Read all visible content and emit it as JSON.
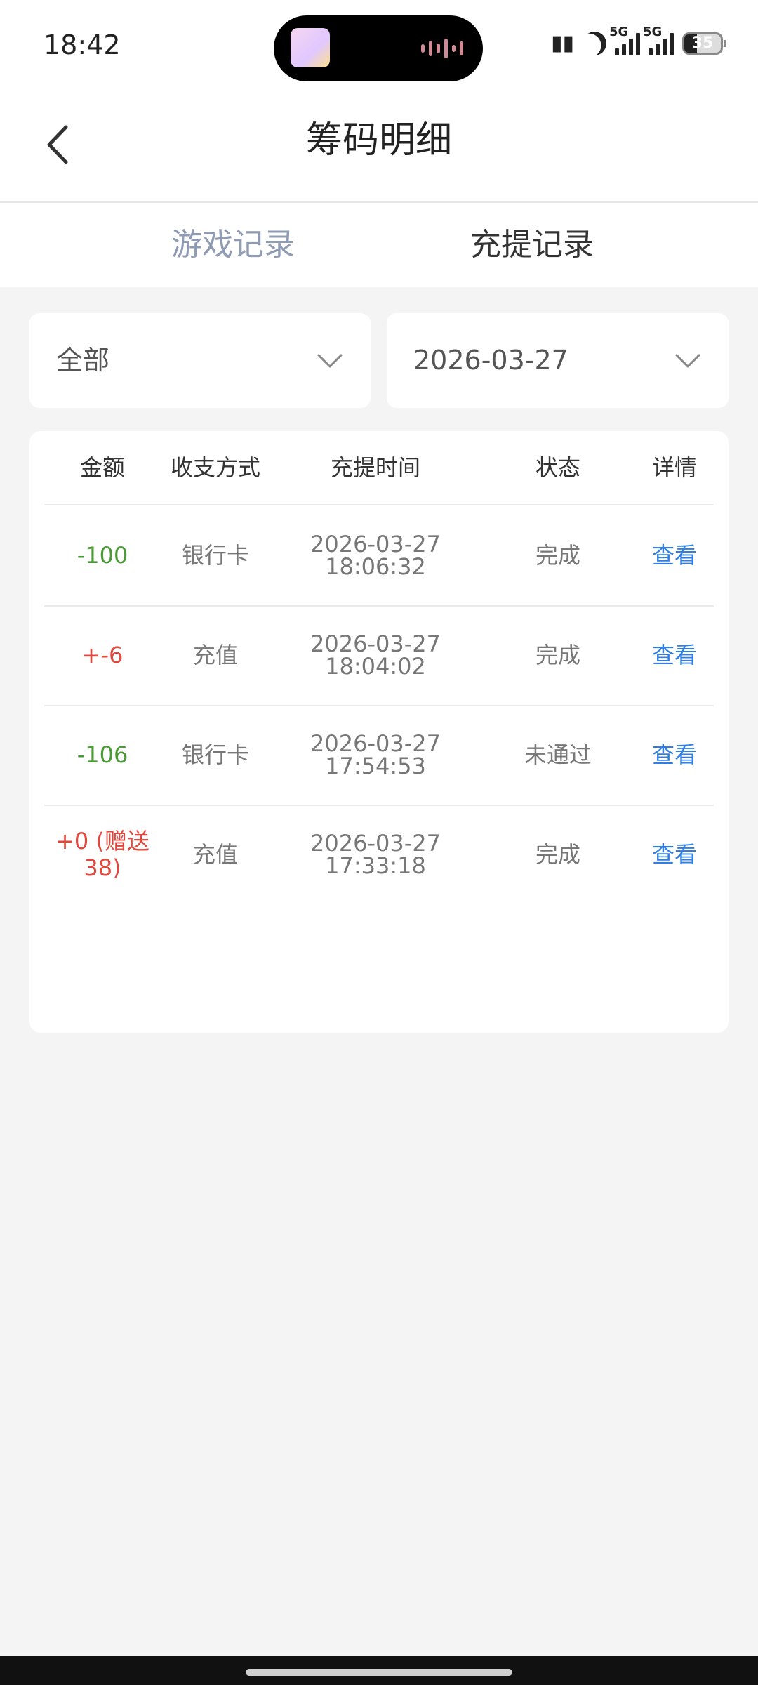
{
  "status_bar": {
    "time": "18:42",
    "network_1": "5G",
    "network_2": "5G",
    "battery": "35"
  },
  "header": {
    "title": "筹码明细"
  },
  "tabs": [
    {
      "label": "游戏记录",
      "active": false
    },
    {
      "label": "充提记录",
      "active": true
    }
  ],
  "filters": {
    "type": "全部",
    "date": "2026-03-27"
  },
  "table": {
    "columns": [
      "金额",
      "收支方式",
      "充提时间",
      "状态",
      "详情"
    ],
    "rows": [
      {
        "amount": "-100",
        "method": "银行卡",
        "date": "2026-03-27",
        "time": "18:06:32",
        "status": "完成",
        "detail": "查看",
        "amount_color": "#4a9a35"
      },
      {
        "amount": "+-6",
        "method": "充值",
        "date": "2026-03-27",
        "time": "18:04:02",
        "status": "完成",
        "detail": "查看",
        "amount_color": "#e0483d"
      },
      {
        "amount": "-106",
        "method": "银行卡",
        "date": "2026-03-27",
        "time": "17:54:53",
        "status": "未通过",
        "detail": "查看",
        "amount_color": "#4a9a35"
      },
      {
        "amount": "+0 (赠送38)",
        "method": "充值",
        "date": "2026-03-27",
        "time": "17:33:18",
        "status": "完成",
        "detail": "查看",
        "amount_color": "#e0483d"
      }
    ]
  },
  "colors": {
    "link": "#2f7ee6",
    "negative": "#4a9a35",
    "positive": "#e0483d",
    "inactive_tab": "#8f9bb3"
  }
}
